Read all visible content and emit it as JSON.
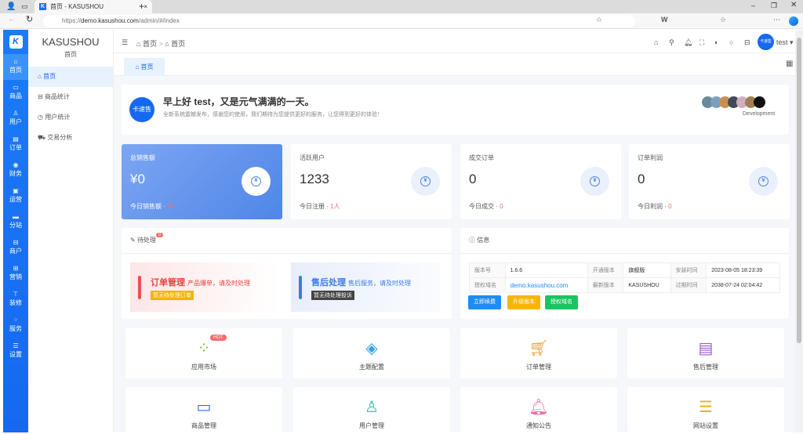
{
  "browser": {
    "tab_title": "首页 - KASUSHOU",
    "url_prefix": "https://",
    "url_domain": "demo.kasushou.com",
    "url_path": "/admin/#/index"
  },
  "rail": {
    "logo": "K",
    "items": [
      {
        "label": "首页",
        "icon": "home-icon"
      },
      {
        "label": "商品",
        "icon": "box-icon"
      },
      {
        "label": "用户",
        "icon": "user-icon"
      },
      {
        "label": "订单",
        "icon": "order-icon"
      },
      {
        "label": "财务",
        "icon": "finance-icon"
      },
      {
        "label": "运营",
        "icon": "operation-icon"
      },
      {
        "label": "分站",
        "icon": "substation-icon"
      },
      {
        "label": "商户",
        "icon": "shop-icon"
      },
      {
        "label": "营销",
        "icon": "gift-icon"
      },
      {
        "label": "装修",
        "icon": "decorate-icon"
      },
      {
        "label": "服务",
        "icon": "service-icon"
      },
      {
        "label": "设置",
        "icon": "settings-icon"
      }
    ]
  },
  "sidebar": {
    "brand": "KASUSHOU",
    "subtitle": "首页",
    "items": [
      {
        "label": "首页",
        "icon": "⌂"
      },
      {
        "label": "商品统计",
        "icon": "⊟"
      },
      {
        "label": "用户统计",
        "icon": "◷"
      },
      {
        "label": "交易分析",
        "icon": "⛟"
      }
    ]
  },
  "header": {
    "breadcrumb": [
      "首页",
      "首页"
    ],
    "user": "test",
    "avatar_text": "卡速售"
  },
  "tabs": {
    "home": "首页"
  },
  "welcome": {
    "avatar_text": "卡速售",
    "title": "早上好 test，又是元气满满的一天。",
    "subtitle": "全新系统震撼发布，感谢您的使用，我们期待为您提供更好的服务，让您得到更好的体验！",
    "team_label": "Development"
  },
  "stats": [
    {
      "label": "总销售额",
      "value": "¥0",
      "sub_label": "今日销售额",
      "sub_value": "0¥"
    },
    {
      "label": "活跃用户",
      "value": "1233",
      "sub_label": "今日注册",
      "sub_value": "1人"
    },
    {
      "label": "成交订单",
      "value": "0",
      "sub_label": "今日成交",
      "sub_value": "0"
    },
    {
      "label": "订单利润",
      "value": "0",
      "sub_label": "今日利润",
      "sub_value": "0"
    }
  ],
  "pending": {
    "title": "待处理",
    "badge": "0",
    "order": {
      "title": "订单管理",
      "desc": "产品爆单，请及时处理",
      "tag": "暂无待处理订单"
    },
    "aftersale": {
      "title": "售后处理",
      "desc": "售后服务，请及时处理",
      "tag": "暂无待处理投诉"
    }
  },
  "info": {
    "title": "信息",
    "rows": [
      [
        "版本号",
        "1.6.6",
        "开通版本",
        "旗舰版",
        "安装时间",
        "2023-08-05 18:23:39"
      ],
      [
        "授权域名",
        "demo.kasushou.com",
        "最新版本",
        "KASUSHOU",
        "过期时间",
        "2038-07-24 02:04:42"
      ]
    ],
    "buttons": [
      "立即续费",
      "升级版本",
      "授权域名"
    ]
  },
  "shortcuts": [
    {
      "label": "应用市场",
      "icon": "apps-icon",
      "badge": "HOT",
      "color": "#67c23a"
    },
    {
      "label": "主题配置",
      "icon": "theme-icon",
      "color": "#36a3e0"
    },
    {
      "label": "订单管理",
      "icon": "cart-icon",
      "color": "#f0a030"
    },
    {
      "label": "售后管理",
      "icon": "document-icon",
      "color": "#9b59d0"
    },
    {
      "label": "商品管理",
      "icon": "archive-icon",
      "color": "#2d6fd8"
    },
    {
      "label": "用户管理",
      "icon": "user-icon",
      "color": "#2fc5b5"
    },
    {
      "label": "通知公告",
      "icon": "bell-icon",
      "color": "#f06aa8"
    },
    {
      "label": "网站设置",
      "icon": "sliders-icon",
      "color": "#f0b020"
    }
  ]
}
